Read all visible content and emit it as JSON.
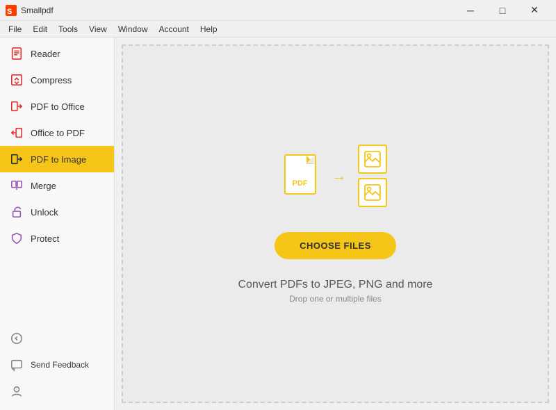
{
  "titleBar": {
    "appName": "Smallpdf",
    "controls": {
      "minimize": "─",
      "maximize": "□",
      "close": "✕"
    }
  },
  "menuBar": {
    "items": [
      "File",
      "Edit",
      "Tools",
      "View",
      "Window",
      "Account",
      "Help"
    ]
  },
  "sidebar": {
    "items": [
      {
        "id": "reader",
        "label": "Reader",
        "icon": "reader-icon"
      },
      {
        "id": "compress",
        "label": "Compress",
        "icon": "compress-icon"
      },
      {
        "id": "pdf-to-office",
        "label": "PDF to Office",
        "icon": "pdf-to-office-icon"
      },
      {
        "id": "office-to-pdf",
        "label": "Office to PDF",
        "icon": "office-to-pdf-icon"
      },
      {
        "id": "pdf-to-image",
        "label": "PDF to Image",
        "icon": "pdf-to-image-icon",
        "active": true
      },
      {
        "id": "merge",
        "label": "Merge",
        "icon": "merge-icon"
      },
      {
        "id": "unlock",
        "label": "Unlock",
        "icon": "unlock-icon"
      },
      {
        "id": "protect",
        "label": "Protect",
        "icon": "protect-icon"
      }
    ],
    "bottomItems": [
      {
        "id": "back",
        "label": "",
        "icon": "back-icon"
      },
      {
        "id": "feedback",
        "label": "Send Feedback",
        "icon": "feedback-icon"
      },
      {
        "id": "account",
        "label": "",
        "icon": "account-icon"
      }
    ]
  },
  "content": {
    "pdfLabel": "PDF",
    "chooseFilesLabel": "CHOOSE FILES",
    "dropTextMain": "Convert PDFs to JPEG, PNG and more",
    "dropTextSub": "Drop one or multiple files"
  }
}
